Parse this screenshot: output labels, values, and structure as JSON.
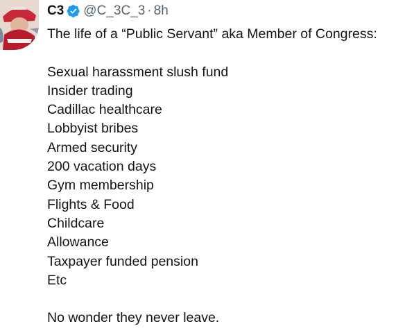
{
  "author": {
    "display_name": "C3",
    "handle": "@C_3C_3",
    "separator": "·",
    "timestamp": "8h",
    "verified_color": "#1d9bf0"
  },
  "tweet": {
    "intro": "The life of a “Public Servant” aka Member of Congress:",
    "items": [
      "Sexual harassment slush fund",
      "Insider trading",
      "Cadillac healthcare",
      "Lobbyist bribes",
      "Armed security",
      "200 vacation days",
      "Gym membership",
      "Flights & Food",
      "Childcare",
      "Allowance",
      "Taxpayer funded pension",
      "Etc"
    ],
    "closing": "No wonder they never leave."
  },
  "icons": {
    "avatar": "avatar-image",
    "verified": "verified-badge-icon"
  }
}
